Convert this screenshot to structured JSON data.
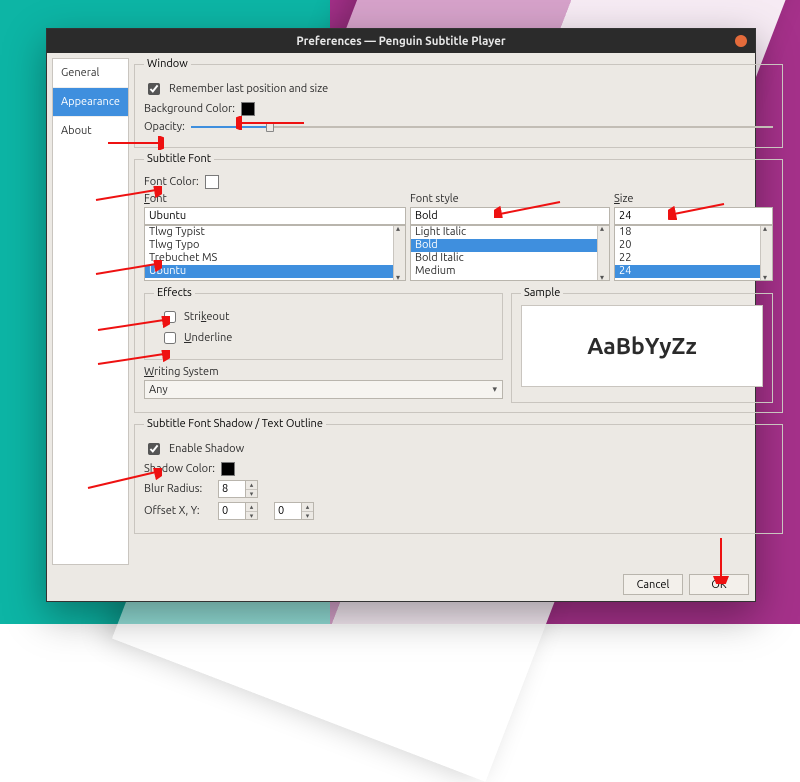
{
  "title": "Preferences — Penguin Subtitle Player",
  "tabs": {
    "general": "General",
    "appearance": "Appearance",
    "about": "About"
  },
  "window": {
    "legend": "Window",
    "remember": "Remember last position and size",
    "bg_label": "Background Color:",
    "opacity_label": "Opacity:"
  },
  "subfont": {
    "legend": "Subtitle Font",
    "font_color_label": "Font Color:",
    "font_head": "Font",
    "style_head": "Font style",
    "size_head": "Size",
    "font_value": "Ubuntu",
    "font_list": [
      "Tlwg Typist",
      "Tlwg Typo",
      "Trebuchet MS",
      "Ubuntu"
    ],
    "font_selected": "Ubuntu",
    "style_value": "Bold",
    "style_list": [
      "Light Italic",
      "Bold",
      "Bold Italic",
      "Medium"
    ],
    "style_selected": "Bold",
    "size_value": "24",
    "size_list": [
      "18",
      "20",
      "22",
      "24"
    ],
    "size_selected": "24",
    "effects_legend": "Effects",
    "strike": "Strikeout",
    "underline": "Underline",
    "ws_label": "Writing System",
    "ws_value": "Any",
    "sample_legend": "Sample",
    "sample_text": "AaBbYyZz"
  },
  "shadow": {
    "legend": "Subtitle Font Shadow / Text Outline",
    "enable": "Enable Shadow",
    "color_label": "Shadow Color:",
    "blur_label": "Blur Radius:",
    "blur_value": "8",
    "offset_label": "Offset X, Y:",
    "ox": "0",
    "oy": "0"
  },
  "buttons": {
    "cancel": "Cancel",
    "ok": "OK"
  }
}
